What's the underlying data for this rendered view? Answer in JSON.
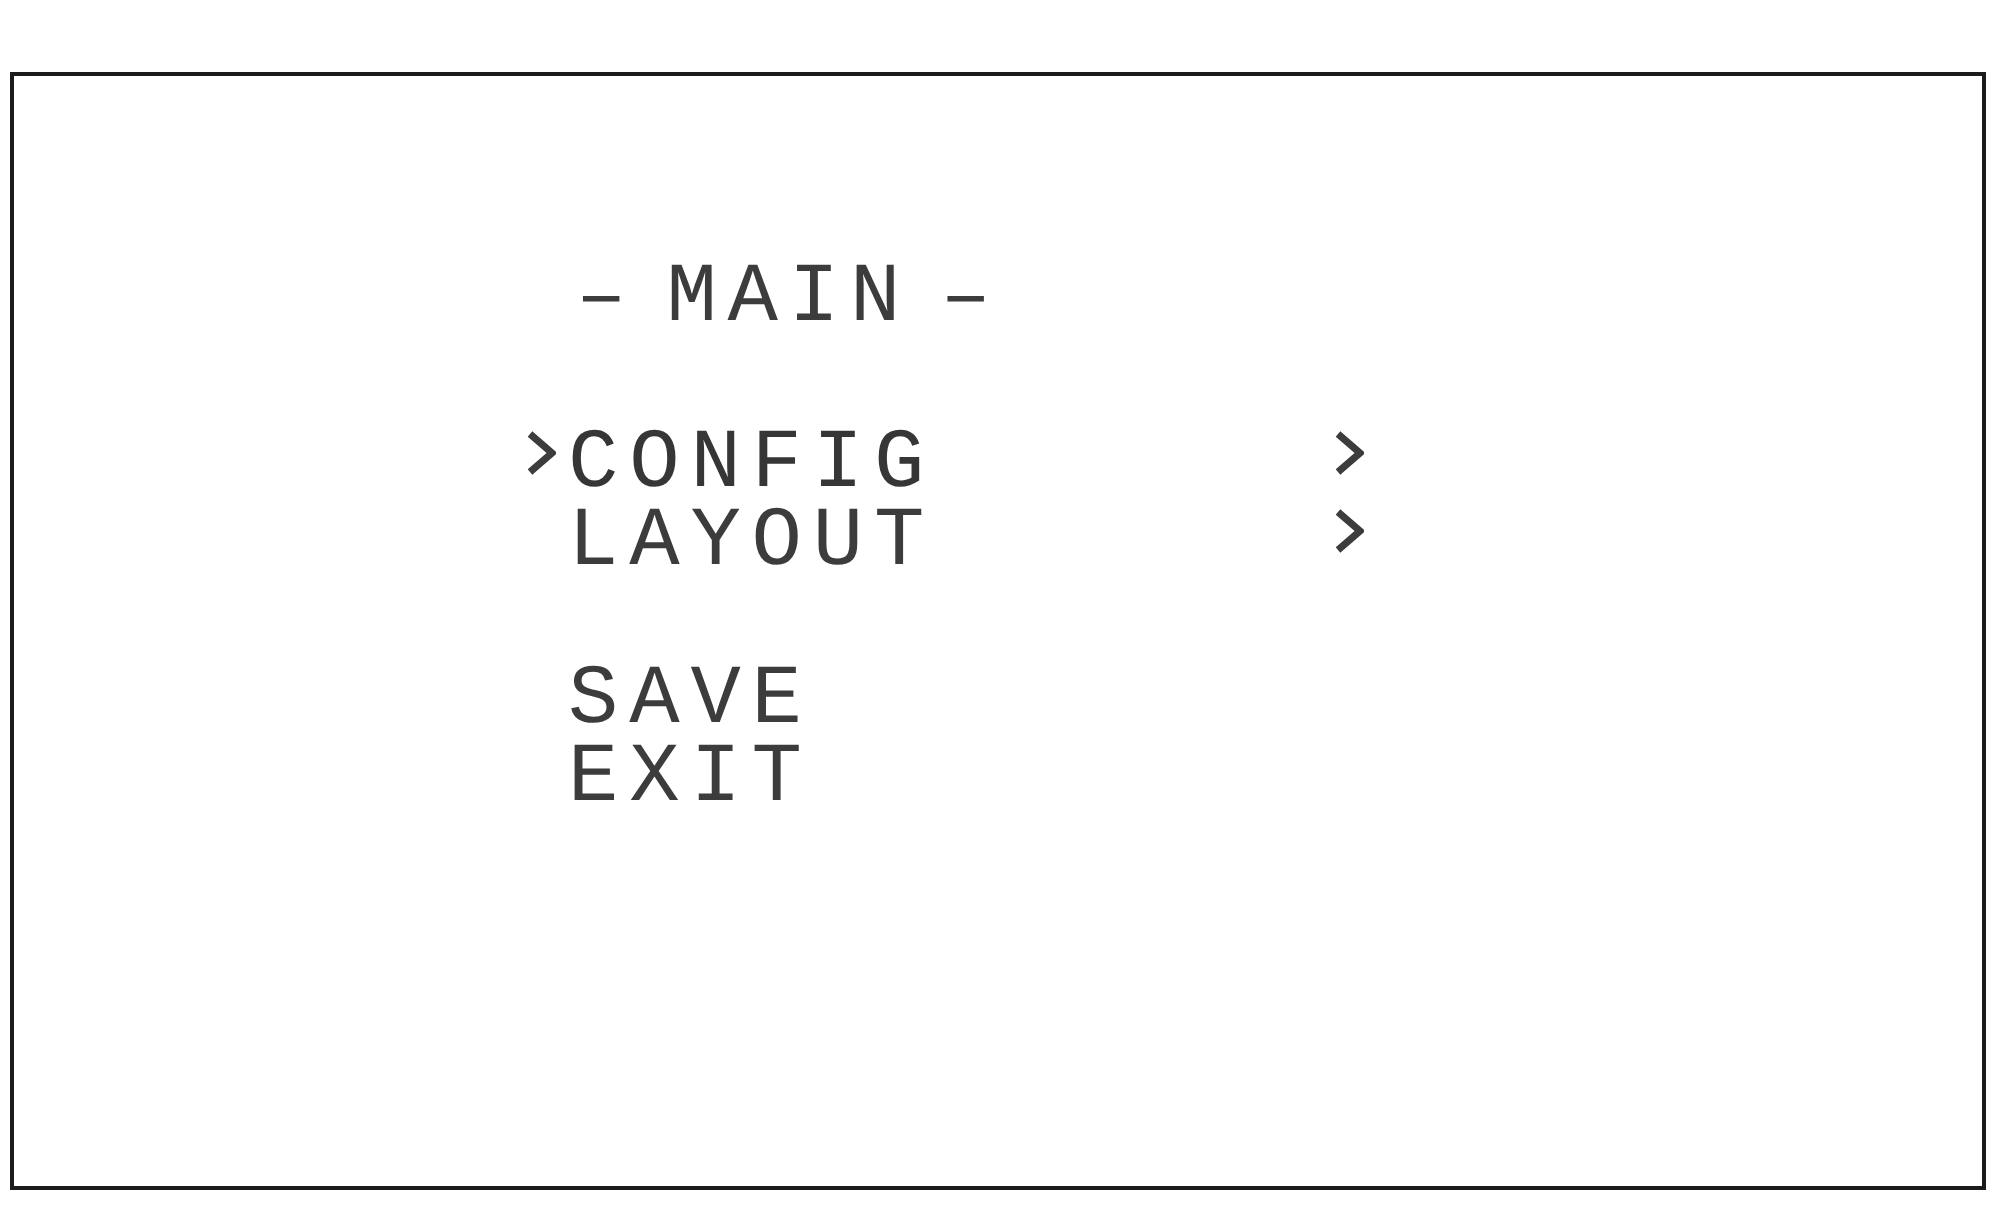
{
  "menu": {
    "title": "– MAIN –",
    "groups": [
      {
        "items": [
          {
            "label": "CONFIG",
            "selected": true,
            "submenu": true
          },
          {
            "label": "LAYOUT",
            "selected": false,
            "submenu": true
          }
        ]
      },
      {
        "items": [
          {
            "label": "SAVE",
            "selected": false,
            "submenu": false
          },
          {
            "label": "EXIT",
            "selected": false,
            "submenu": false
          }
        ]
      }
    ]
  }
}
